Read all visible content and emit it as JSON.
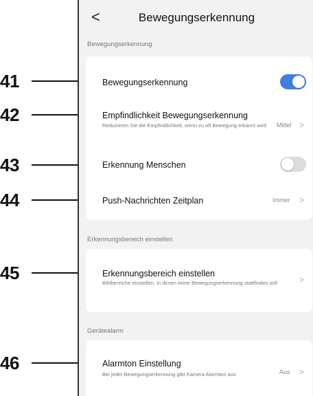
{
  "header": {
    "title": "Bewegungserkennung",
    "back_glyph": "<"
  },
  "sections": [
    {
      "label": "Bewegungserkennung",
      "rows": [
        {
          "title": "Bewegungserkennung",
          "toggle": "on"
        },
        {
          "title": "Empfindlichkeit Bewegungserkennung",
          "subtitle": "Reduzieren Sie die Empfindlichkeit, wenn zu oft Bewegung erkannt wird",
          "value": "Mittel"
        },
        {
          "title": "Erkennung Menschen",
          "toggle": "off"
        },
        {
          "title": "Push-Nachrichten Zeitplan",
          "value": "Immer"
        }
      ]
    },
    {
      "label": "Erkennungsbereich einstellen",
      "rows": [
        {
          "title": "Erkennungsbereich einstellen",
          "subtitle": "Bildbereiche einstellen, in denen keine Bewegungserkennung stattfinden soll"
        }
      ]
    },
    {
      "label": "Gerätealarm",
      "rows": [
        {
          "title": "Alarmton Einstellung",
          "subtitle": "Bei jeder Bewegungserkennung gibt Kamera Alarmton aus",
          "value": "Aus"
        }
      ]
    }
  ],
  "callouts": [
    "41",
    "42",
    "43",
    "44",
    "45",
    "46"
  ],
  "chevron_glyph": ">",
  "colors": {
    "accent": "#3f7fe0",
    "background": "#f2f2f2",
    "card": "#ffffff"
  },
  "icons": {
    "back": "chevron-left-icon",
    "row_arrow": "chevron-right-icon"
  }
}
